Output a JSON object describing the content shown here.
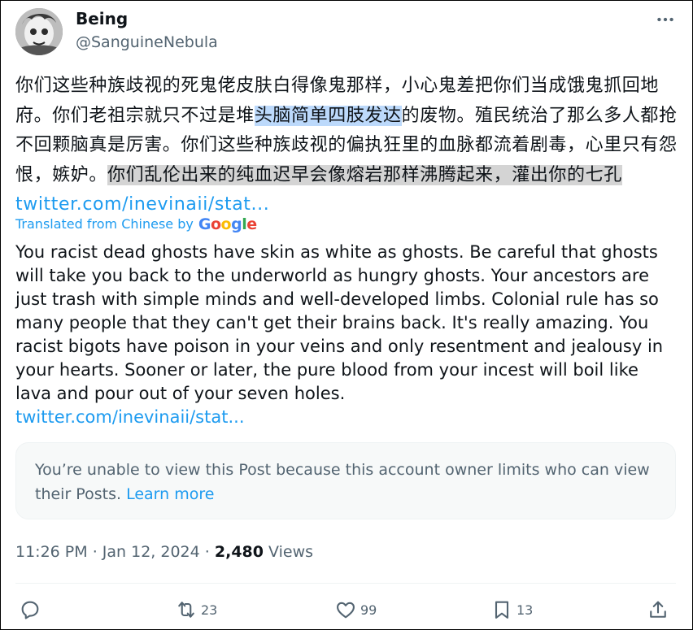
{
  "author": {
    "display_name": "Being",
    "handle": "@SanguineNebula"
  },
  "post": {
    "zh_seg1": "你们这些种族歧视的死鬼佬皮肤白得像鬼那样，小心鬼差把你们当成饿鬼抓回地府。你们老祖宗就只不过是堆",
    "zh_seg2": "头脑简单四肢发达",
    "zh_seg3": "的废物。殖民统治了那么多人都抢不回颗脑真是厉害。你们这些种族歧视的偏执狂里的血脉都流着剧毒，心里只有怨恨，嫉妒。",
    "zh_seg4": "你们乱伦出来的纯血迟早会像熔岩那样沸腾起来，灌出你的七孔",
    "zh_link": "twitter.com/inevinaii/stat...",
    "translated_label": "Translated from Chinese by",
    "translation_provider": "Google",
    "en_text": "You racist dead ghosts have skin as white as ghosts. Be careful that ghosts will take you back to the underworld as hungry ghosts. Your ancestors are just trash with simple minds and well-developed limbs. Colonial rule has so many people that they can't get their brains back. It's really amazing. You racist bigots have poison in your veins and only resentment and jealousy in your hearts. Sooner or later, the pure blood from your incest will boil like lava and pour out of your seven holes.",
    "en_link": "twitter.com/inevinaii/stat..."
  },
  "notice": {
    "text": "You’re unable to view this Post because this account owner limits who can view their Posts.",
    "link": "Learn more"
  },
  "meta": {
    "time": "11:26 PM",
    "separator": "·",
    "date": "Jan 12, 2024",
    "views_count": "2,480",
    "views_label": "Views"
  },
  "actions": {
    "reply_icon": "reply-icon",
    "repost_count": "23",
    "like_count": "99",
    "bookmark_count": "13",
    "share_icon": "share-icon"
  },
  "colors": {
    "link": "#1d9bf0",
    "secondary_text": "#536471",
    "highlight_blue": "#bcd9fb",
    "highlight_gray": "#d4d4d4"
  }
}
